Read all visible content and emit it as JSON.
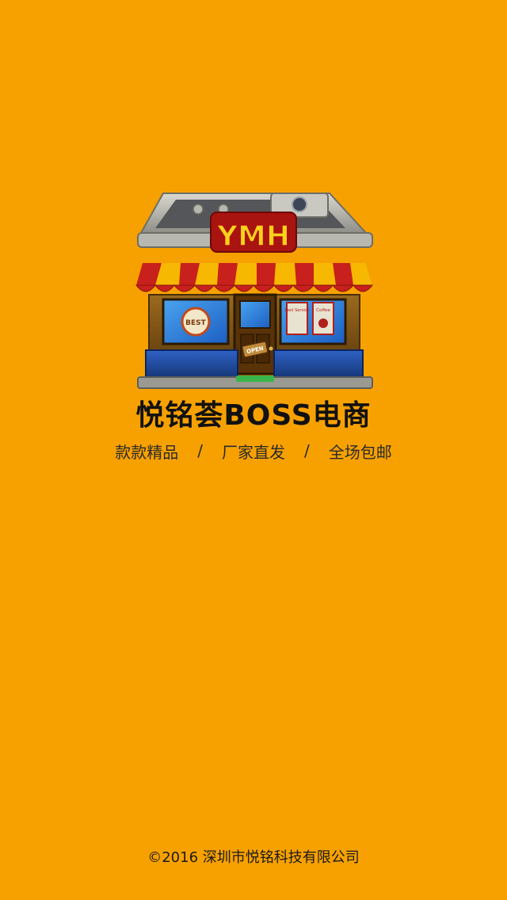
{
  "logo": {
    "sign_text": "YMH",
    "door_sign": "OPEN",
    "poster_left": "BEST",
    "poster_best_service": "Best Service",
    "poster_coffee": "Coffee"
  },
  "brand": {
    "title": "悦铭荟BOSS电商"
  },
  "tagline": {
    "items": [
      "款款精品",
      "厂家直发",
      "全场包邮"
    ],
    "separator": "/"
  },
  "footer": {
    "copyright": "©2016 深圳市悦铭科技有限公司"
  },
  "colors": {
    "background": "#F7A100",
    "awning_red": "#C8201C",
    "awning_yellow": "#F6B800",
    "store_blue": "#1F4FA8",
    "store_brown": "#7A4A12"
  }
}
